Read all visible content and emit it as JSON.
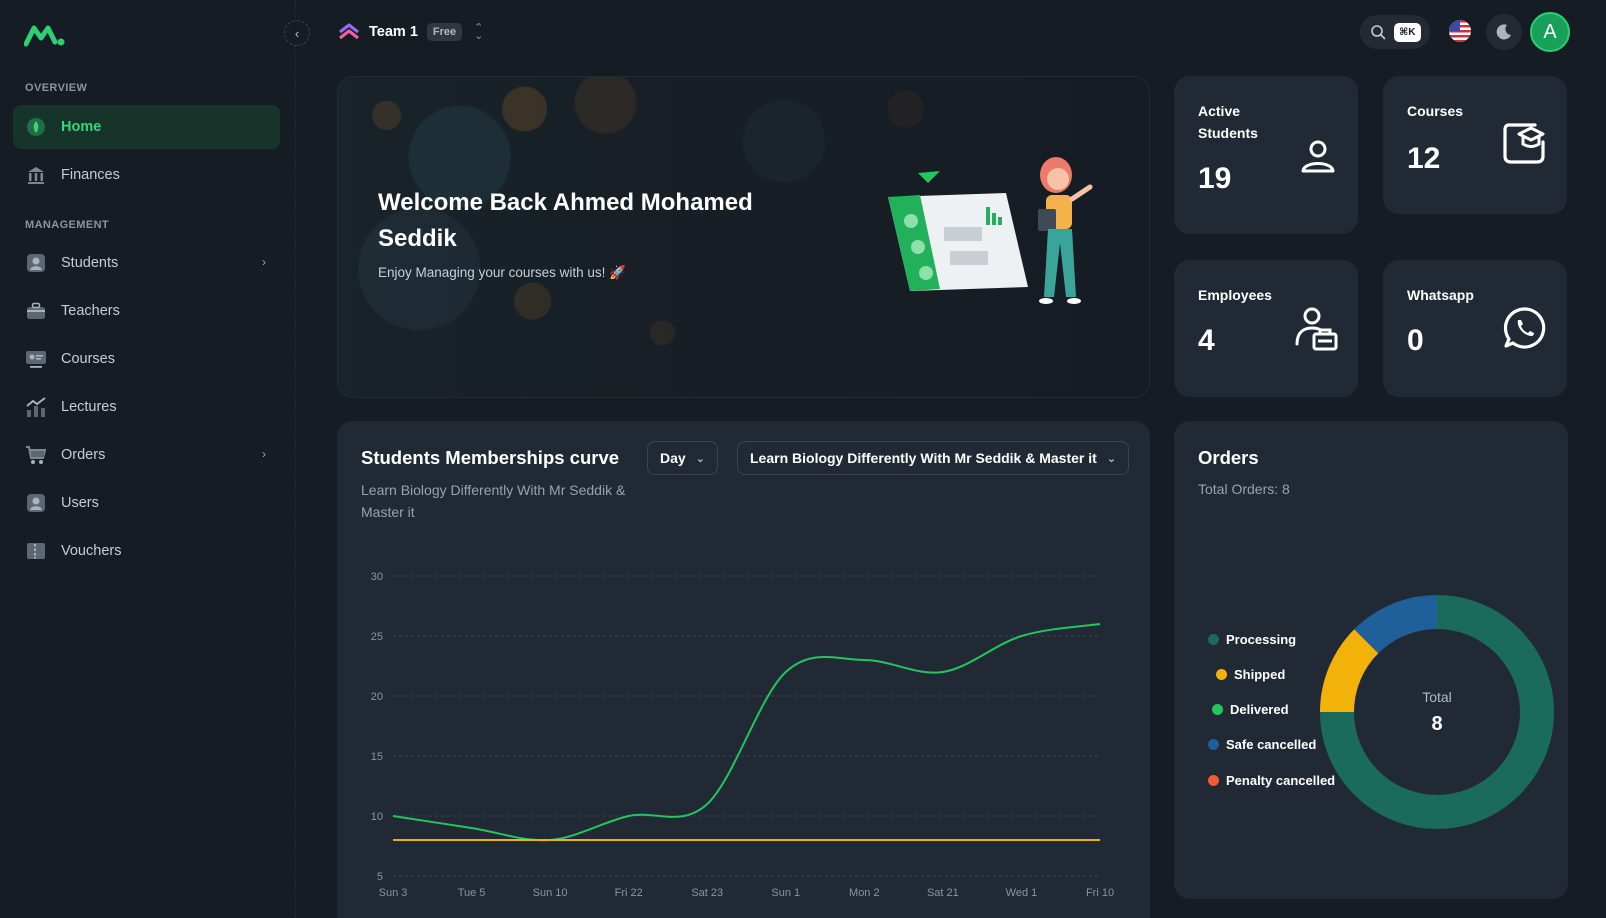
{
  "sidebar": {
    "overview_label": "OVERVIEW",
    "management_label": "MANAGEMENT",
    "items": [
      {
        "label": "Home"
      },
      {
        "label": "Finances"
      },
      {
        "label": "Students"
      },
      {
        "label": "Teachers"
      },
      {
        "label": "Courses"
      },
      {
        "label": "Lectures"
      },
      {
        "label": "Orders"
      },
      {
        "label": "Users"
      },
      {
        "label": "Vouchers"
      }
    ]
  },
  "header": {
    "team_name": "Team 1",
    "plan_badge": "Free",
    "search_shortcut": "⌘K",
    "avatar_initial": "A"
  },
  "welcome": {
    "title": "Welcome Back Ahmed Mohamed Seddik",
    "subtitle": "Enjoy Managing your courses with us! 🚀"
  },
  "stats": [
    {
      "label": "Active Students",
      "value": "19",
      "icon": "user-icon"
    },
    {
      "label": "Courses",
      "value": "12",
      "icon": "graduation-cap-icon"
    },
    {
      "label": "Employees",
      "value": "4",
      "icon": "employee-icon"
    },
    {
      "label": "Whatsapp",
      "value": "0",
      "icon": "whatsapp-icon"
    }
  ],
  "memberships": {
    "title": "Students Memberships curve",
    "subtitle": "Learn Biology Differently With Mr Seddik & Master it",
    "period_select": "Day",
    "course_select": "Learn Biology Differently With Mr Seddik & Master it"
  },
  "chart_data": {
    "type": "line",
    "x": [
      "Sun 3",
      "Tue 5",
      "Sun 10",
      "Fri 22",
      "Sat 23",
      "Sun 1",
      "Mon 2",
      "Sat 21",
      "Wed 1",
      "Fri 10"
    ],
    "series": [
      {
        "values": [
          10,
          9,
          8,
          10,
          11,
          22,
          23,
          22,
          25,
          26
        ],
        "color": "#22c55e"
      },
      {
        "values": [
          8,
          8,
          8,
          8,
          8,
          8,
          8,
          8,
          8,
          8
        ],
        "color": "#eab308"
      }
    ],
    "ylim": [
      5,
      30
    ],
    "yticks": [
      "5",
      "10",
      "15",
      "20",
      "25",
      "30"
    ],
    "grid": true
  },
  "orders": {
    "title": "Orders",
    "subtitle": "Total Orders: 8",
    "total_label": "Total",
    "total_value": "8",
    "legend": [
      {
        "label": "Processing",
        "color": "#1a6b5a",
        "value": 6
      },
      {
        "label": "Shipped",
        "color": "#f2b20a",
        "value": 1
      },
      {
        "label": "Delivered",
        "color": "#22c55e",
        "value": 0
      },
      {
        "label": "Safe cancelled",
        "color": "#1f5f9a",
        "value": 1
      },
      {
        "label": "Penalty cancelled",
        "color": "#f05a35",
        "value": 0
      }
    ]
  }
}
